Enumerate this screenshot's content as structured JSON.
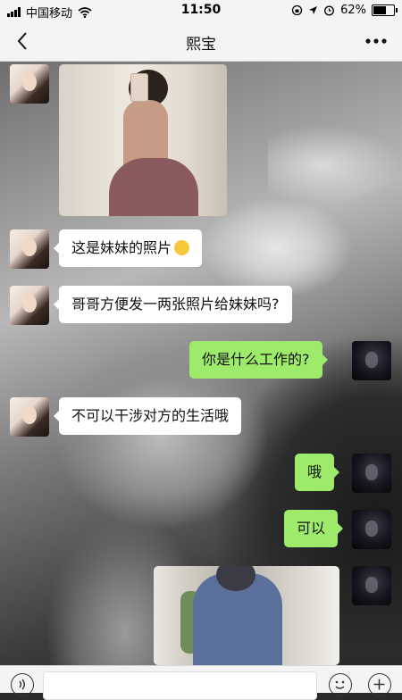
{
  "status_bar": {
    "carrier": "中国移动",
    "time": "11:50",
    "battery_text": "62%",
    "battery_level": 0.62,
    "icons": [
      "signal-icon",
      "wifi-icon",
      "lock-rotation-icon",
      "location-icon",
      "alarm-icon",
      "battery-icon"
    ]
  },
  "nav": {
    "title": "熙宝",
    "back_icon": "back-chevron-icon",
    "more_icon": "more-dots-icon"
  },
  "messages": [
    {
      "from": "contact",
      "type": "image",
      "description_icon": "photo-icon"
    },
    {
      "from": "contact",
      "type": "text",
      "text": "这是妹妹的照片",
      "emoji": "smiling-face-emoji"
    },
    {
      "from": "contact",
      "type": "text",
      "text": "哥哥方便发一两张照片给妹妹吗?"
    },
    {
      "from": "me",
      "type": "text",
      "text": "你是什么工作的?"
    },
    {
      "from": "contact",
      "type": "text",
      "text": "不可以干涉对方的生活哦"
    },
    {
      "from": "me",
      "type": "text",
      "text": "哦"
    },
    {
      "from": "me",
      "type": "text",
      "text": "可以"
    },
    {
      "from": "me",
      "type": "image",
      "description_icon": "photo-icon"
    }
  ],
  "input_bar": {
    "voice_icon": "voice-icon",
    "emoji_icon": "emoji-icon",
    "add_icon": "plus-icon"
  },
  "colors": {
    "outgoing_bubble": "#9eea6a",
    "incoming_bubble": "#ffffff",
    "bar_background": "#f4f4f4"
  }
}
